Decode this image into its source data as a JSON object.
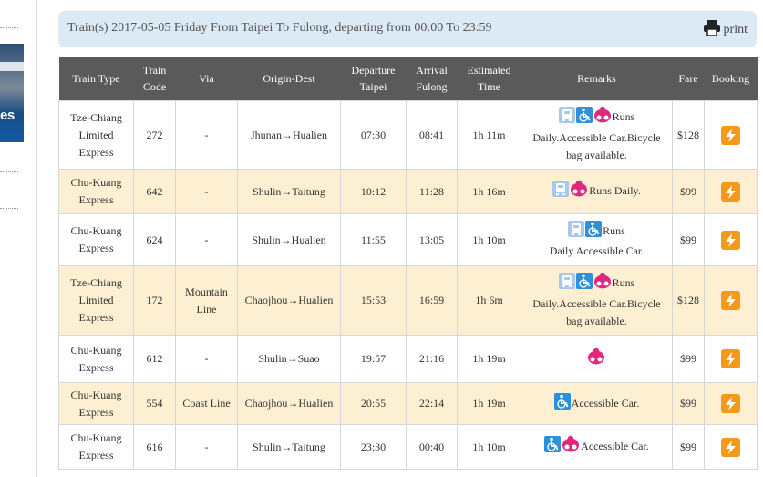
{
  "search": {
    "summary": "Train(s) 2017-05-05 Friday From Taipei To Fulong, departing from 00:00 To 23:59",
    "print_label": "print"
  },
  "sidebar": {
    "promo_text": "es"
  },
  "table": {
    "headers": {
      "train_type": "Train Type",
      "train_code_1": "Train",
      "train_code_2": "Code",
      "via": "Via",
      "origin_dest": "Origin-Dest",
      "departure_1": "Departure",
      "departure_2": "Taipei",
      "arrival_1": "Arrival",
      "arrival_2": "Fulong",
      "estimated_1": "Estimated",
      "estimated_2": "Time",
      "remarks": "Remarks",
      "fare": "Fare",
      "booking": "Booking"
    },
    "rows": [
      {
        "type_1": "Tze-Chiang",
        "type_2": "Limited",
        "type_3": "Express",
        "code": "272",
        "via_1": "-",
        "via_2": "",
        "od": "Jhunan→Hualien",
        "dep": "07:30",
        "arr": "08:41",
        "time": "1h 11m",
        "remark_1": "Runs",
        "remark_2": "Daily.Accessible Car.Bicycle",
        "remark_3": "bag available.",
        "fare": "$128"
      },
      {
        "type_1": "Chu-Kuang",
        "type_2": "Express",
        "type_3": "",
        "code": "642",
        "via_1": "-",
        "via_2": "",
        "od": "Shulin→Taitung",
        "dep": "10:12",
        "arr": "11:28",
        "time": "1h 16m",
        "remark_1": "Runs Daily.",
        "remark_2": "",
        "remark_3": "",
        "fare": "$99"
      },
      {
        "type_1": "Chu-Kuang",
        "type_2": "Express",
        "type_3": "",
        "code": "624",
        "via_1": "-",
        "via_2": "",
        "od": "Shulin→Hualien",
        "dep": "11:55",
        "arr": "13:05",
        "time": "1h 10m",
        "remark_1": "Runs",
        "remark_2": "Daily.Accessible Car.",
        "remark_3": "",
        "fare": "$99"
      },
      {
        "type_1": "Tze-Chiang",
        "type_2": "Limited",
        "type_3": "Express",
        "code": "172",
        "via_1": "Mountain",
        "via_2": "Line",
        "od": "Chaojhou→Hualien",
        "dep": "15:53",
        "arr": "16:59",
        "time": "1h 6m",
        "remark_1": "Runs",
        "remark_2": "Daily.Accessible Car.Bicycle",
        "remark_3": "bag available.",
        "fare": "$128"
      },
      {
        "type_1": "Chu-Kuang",
        "type_2": "Express",
        "type_3": "",
        "code": "612",
        "via_1": "-",
        "via_2": "",
        "od": "Shulin→Suao",
        "dep": "19:57",
        "arr": "21:16",
        "time": "1h 19m",
        "remark_1": "",
        "remark_2": "",
        "remark_3": "",
        "fare": "$99"
      },
      {
        "type_1": "Chu-Kuang",
        "type_2": "Express",
        "type_3": "",
        "code": "554",
        "via_1": "Coast Line",
        "via_2": "",
        "od": "Chaojhou→Hualien",
        "dep": "20:55",
        "arr": "22:14",
        "time": "1h 19m",
        "remark_1": "Accessible Car.",
        "remark_2": "",
        "remark_3": "",
        "fare": "$99"
      },
      {
        "type_1": "Chu-Kuang",
        "type_2": "Express",
        "type_3": "",
        "code": "616",
        "via_1": "-",
        "via_2": "",
        "od": "Shulin→Taitung",
        "dep": "23:30",
        "arr": "00:40",
        "time": "1h 10m",
        "remark_1": "Accessible Car.",
        "remark_2": "",
        "remark_3": "",
        "fare": "$99"
      }
    ]
  },
  "colors": {
    "header_bg": "#5a5a5a",
    "alt_row_bg": "#fdf0d2",
    "title_bar_bg": "#dceaf6",
    "booking_orange": "#f39a1a",
    "wheelchair_blue": "#2f8fd8",
    "bicycle_magenta": "#e0287f"
  },
  "icons": [
    "print-icon",
    "daily-train-icon",
    "wheelchair-icon",
    "bicycle-bag-icon",
    "booking-icon"
  ]
}
